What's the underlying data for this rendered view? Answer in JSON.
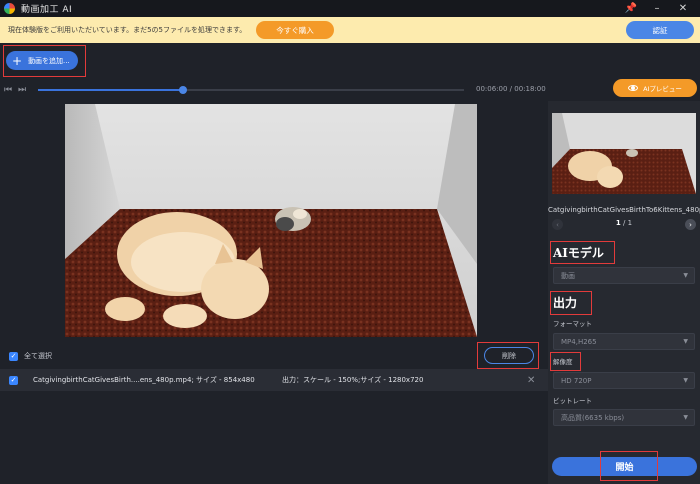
{
  "app": {
    "title": "動画加工 AI"
  },
  "window": {
    "pin": "📌",
    "minimize": "–",
    "close": "✕"
  },
  "banner": {
    "text": "現在体験版をご利用いただいています。まだ5の5ファイルを処理できます。",
    "buy_label": "今すぐ購入",
    "auth_label": "認証"
  },
  "toolbar": {
    "add_label": "動画を追加...",
    "add_icon": "+"
  },
  "player": {
    "prev_icon": "⏮",
    "next_icon": "⏭",
    "progress": 0.34,
    "time": "00:06:00 / 00:18:00"
  },
  "preview_button": {
    "label": "AIプレビュー"
  },
  "list": {
    "select_all_label": "全て選択",
    "delete_label": "削除",
    "check_icon": "✓",
    "rows": [
      {
        "filename": "CatgivingbirthCatGivesBirth....ens_480p.mp4; サイズ - 854x480",
        "output": "出力：スケール - 150%;サイズ - 1280x720",
        "close_icon": "✕"
      }
    ]
  },
  "side": {
    "thumb_name": "CatgivingbirthCatGivesBirthTo6Kittens_480p.mp4",
    "pager": {
      "current": "1",
      "sep": " / ",
      "total": "1",
      "prev_icon": "‹",
      "next_icon": "›"
    },
    "ai_model_title": "AIモデル",
    "model_value": "動画",
    "output_title": "出力",
    "format_label": "フォーマット",
    "format_value": "MP4,H265",
    "resolution_label": "解像度",
    "resolution_value": "HD 720P",
    "bitrate_label": "ビットレート",
    "bitrate_value": "高品質(6635 kbps)",
    "start_label": "開始"
  },
  "colors": {
    "accent": "#3a73dc",
    "orange": "#f49a28",
    "highlight_box": "#e23b3b"
  }
}
